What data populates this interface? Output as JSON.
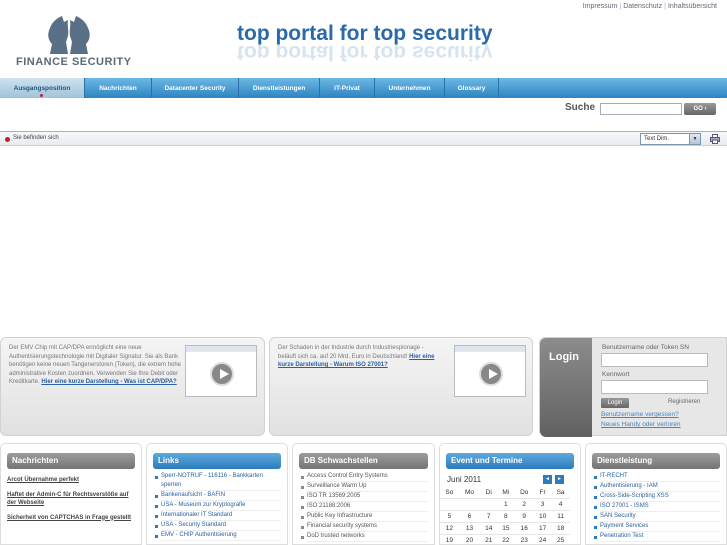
{
  "topbar": {
    "links": [
      "Impressum",
      "Datenschutz",
      "Inhaltsübersicht"
    ]
  },
  "logo": {
    "text": "FINANCE SECURITY"
  },
  "tagline": "top portal for top security",
  "nav": {
    "items": [
      "Ausgangsposition",
      "Nachrichten",
      "Datacenter Security",
      "Dienstleistungen",
      "IT-Privat",
      "Unternehmen",
      "Glossary"
    ]
  },
  "search": {
    "label": "Suche",
    "placeholder": "",
    "button": "GO ›"
  },
  "breadcrumb": {
    "label": "Sie befinden sich"
  },
  "textdim": {
    "label": "Text Dim."
  },
  "promos": [
    {
      "text": "Der EMV Chip mit CAP/DPA ermöglicht eine neue Authentisierungstechnologie mit Digitaler Signatur. Sie als Bank benötigen keine neuen Tangenerstoren (Token), die extrem hohe administrative Kosten zuordnen. Verwenden Sie Ihre Debit oder Kreditkarte.",
      "link": "Hier eine kurze Darstellung - Was ist CAP/DPA?"
    },
    {
      "text": "Der Schaden in der Industrie durch Industriespionage - beläuft sich ca. auf 20 Mrd. Euro in Deutschland!",
      "link": "Hier eine kurze Darstellung - Warum ISO 27001?"
    }
  ],
  "login": {
    "title": "Login",
    "user_label": "Benutzername oder Token SN",
    "pass_label": "Kennwort",
    "button": "Login",
    "register": "Registrieren",
    "forgot": "Benutzername vergessen?",
    "reset": "Neues Handy oder verloren"
  },
  "nachrichten": {
    "title": "Nachrichten",
    "items": [
      "Arcot Übernahme perfekt",
      "Haftet der Admin-C für Rechtsverstöße auf der Webseite",
      "Sicherheit von CAPTCHAS in Frage gestellt"
    ]
  },
  "links": {
    "title": "Links",
    "items": [
      "Sperr-NOTRUF - 116116 - Bankkarten sperren",
      "Bankenaufsicht - BAFIN",
      "USA - Museum zur Kryptografie",
      "Internationaler IT Standard",
      "USA - Security Standard",
      "EMV - CHIP Authentisierung"
    ]
  },
  "schwachstellen": {
    "title": "DB Schwachstellen",
    "items": [
      "Access Control Entry Systems",
      "Surveillance Warm Up",
      "ISO TR 13569:2005",
      "ISO 21188:2006",
      "Public Key Infrastructure",
      "Financial security systems",
      "DoD trusted networks"
    ]
  },
  "calendar": {
    "title": "Event und Termine",
    "month": "Juni 2011",
    "prev": "◄",
    "next": "►",
    "days": [
      "So",
      "Mo",
      "Di",
      "Mi",
      "Do",
      "Fr",
      "Sa"
    ],
    "weeks": [
      [
        "",
        "",
        "",
        "1",
        "2",
        "3",
        "4"
      ],
      [
        "5",
        "6",
        "7",
        "8",
        "9",
        "10",
        "11"
      ],
      [
        "12",
        "13",
        "14",
        "15",
        "16",
        "17",
        "18"
      ],
      [
        "19",
        "20",
        "21",
        "22",
        "23",
        "24",
        "25"
      ]
    ]
  },
  "dienstleistung": {
    "title": "Dienstleistung",
    "items": [
      "IT-RECHT",
      "Authentisierung - IAM",
      "Cross-Side-Scripting XSS",
      "ISO 27001 - ISMS",
      "SAN Security",
      "Payment Services",
      "Penetration Test"
    ]
  }
}
